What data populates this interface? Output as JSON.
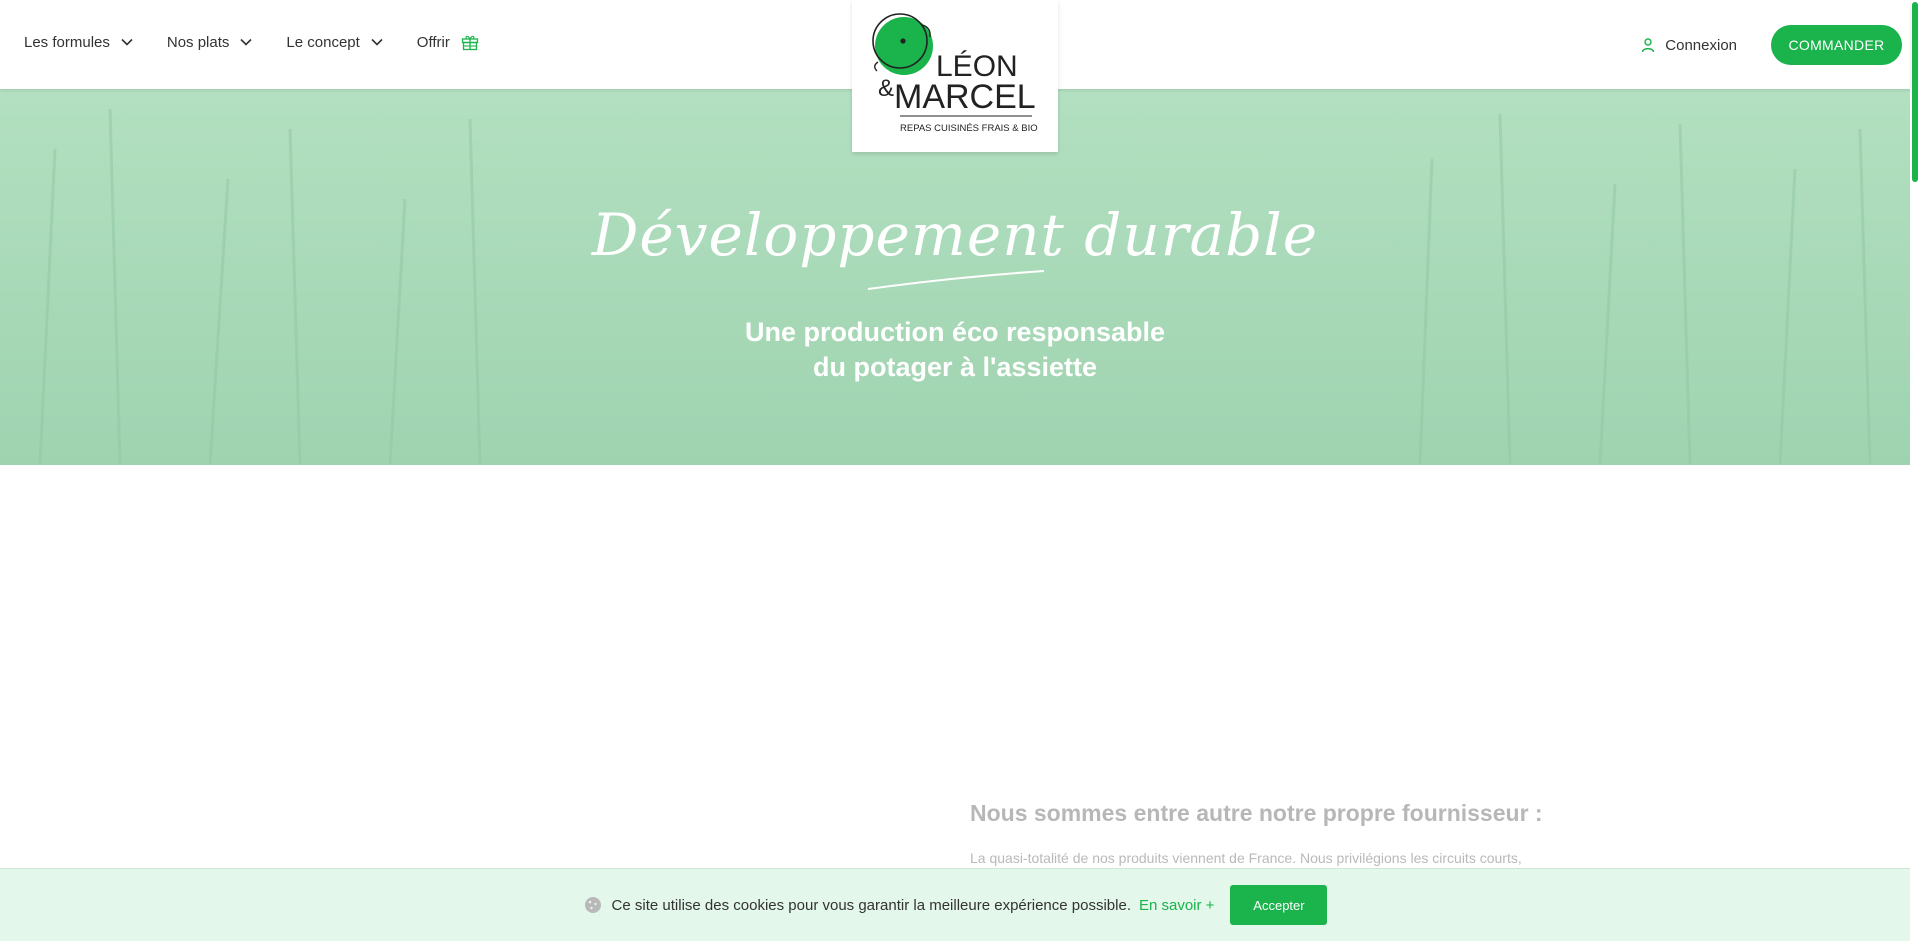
{
  "nav": {
    "items": [
      {
        "label": "Les formules"
      },
      {
        "label": "Nos plats"
      },
      {
        "label": "Le concept"
      }
    ],
    "offrir_label": "Offrir"
  },
  "logo": {
    "line1": "LÉON",
    "amp": "&",
    "line2": "MARCEL",
    "tagline": "REPAS CUISINÉS FRAIS & BIO"
  },
  "header_right": {
    "connexion_label": "Connexion",
    "commander_label": "COMMANDER"
  },
  "hero": {
    "title": "Développement durable",
    "subtitle_line1": "Une production éco responsable",
    "subtitle_line2": "du potager à l'assiette"
  },
  "section": {
    "title": "Nous sommes entre autre notre propre fournisseur :",
    "text": "La quasi-totalité de nos produits viennent de France. Nous privilégions les circuits courts,"
  },
  "cookie": {
    "message": "Ce site utilise des cookies pour vous garantir la meilleure expérience possible.",
    "more_label": "En savoir +",
    "accept_label": "Accepter"
  },
  "colors": {
    "brand_green": "#1ab34c",
    "hero_green": "#a9dbb9",
    "cookie_bg": "#e3f7ea"
  },
  "icons": {
    "dropdown": "chevron-down-icon",
    "gift": "gift-icon",
    "user": "user-icon",
    "cookie": "cookie-icon"
  }
}
